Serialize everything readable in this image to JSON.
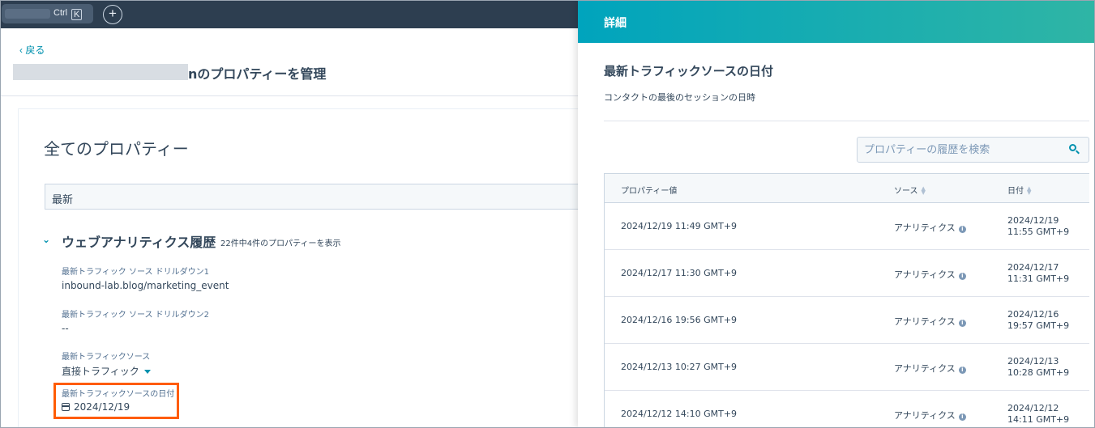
{
  "topbar": {
    "search_shortcut_ctrl": "Ctrl",
    "search_shortcut_k": "K",
    "add_button": "+"
  },
  "left": {
    "back": "‹ 戻る",
    "page_title": "nのプロパティーを管理",
    "all_properties": "全てのプロパティー",
    "filter_value": "最新",
    "section": {
      "title": "ウェブアナリティクス履歴",
      "count": "22件中4件のプロパティーを表示"
    },
    "properties": [
      {
        "label": "最新トラフィック ソース ドリルダウン1",
        "value": "inbound-lab.blog/marketing_event"
      },
      {
        "label": "最新トラフィック ソース ドリルダウン2",
        "value": "--"
      },
      {
        "label": "最新トラフィックソース",
        "value": "直接トラフィック"
      },
      {
        "label": "最新トラフィックソースの日付",
        "value": "2024/12/19"
      }
    ]
  },
  "panel": {
    "header_title": "詳細",
    "title": "最新トラフィックソースの日付",
    "description": "コンタクトの最後のセッションの日時",
    "search_placeholder": "プロパティーの履歴を検索",
    "columns": {
      "value": "プロパティー値",
      "source": "ソース",
      "date": "日付"
    },
    "rows": [
      {
        "value": "2024/12/19 11:49 GMT+9",
        "source": "アナリティクス",
        "date_line1": "2024/12/19",
        "date_line2": "11:55 GMT+9"
      },
      {
        "value": "2024/12/17 11:30 GMT+9",
        "source": "アナリティクス",
        "date_line1": "2024/12/17",
        "date_line2": "11:31 GMT+9"
      },
      {
        "value": "2024/12/16 19:56 GMT+9",
        "source": "アナリティクス",
        "date_line1": "2024/12/16",
        "date_line2": "19:57 GMT+9"
      },
      {
        "value": "2024/12/13 10:27 GMT+9",
        "source": "アナリティクス",
        "date_line1": "2024/12/13",
        "date_line2": "10:28 GMT+9"
      },
      {
        "value": "2024/12/12 14:10 GMT+9",
        "source": "アナリティクス",
        "date_line1": "2024/12/12",
        "date_line2": "14:11 GMT+9"
      }
    ]
  },
  "colors": {
    "topbar": "#2d3e50",
    "accent": "#0091ae",
    "header_gradient_start": "#00a4bd",
    "header_gradient_end": "#2fb5a5",
    "highlight": "#ff5c00"
  }
}
